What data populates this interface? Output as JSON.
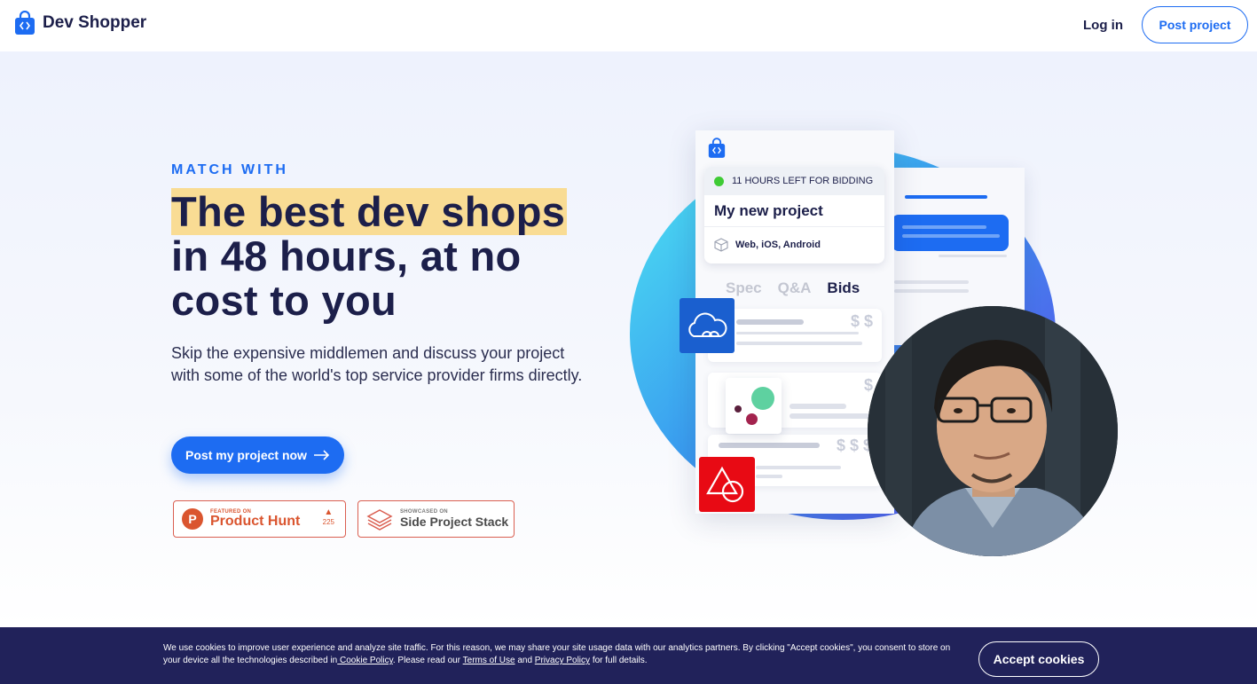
{
  "header": {
    "brand": "Dev Shopper",
    "login_label": "Log in",
    "post_project_label": "Post project"
  },
  "hero": {
    "eyebrow": "MATCH WITH",
    "headline_highlight": "The best dev shops",
    "headline_rest_1": "in 48 hours, at no",
    "headline_rest_2": "cost to you",
    "subtext": "Skip the expensive middlemen and discuss your project with some of the world's top service provider firms directly.",
    "cta_label": "Post my project now"
  },
  "badges": {
    "product_hunt": {
      "small": "FEATURED ON",
      "big": "Product Hunt",
      "count": "225"
    },
    "side_project_stack": {
      "small": "SHOWCASED ON",
      "big": "Side Project Stack"
    }
  },
  "illustration": {
    "bidding_status": "11 HOURS LEFT FOR BIDDING",
    "project_title": "My new project",
    "platforms": "Web, iOS, Android",
    "tabs": [
      "Spec",
      "Q&A",
      "Bids"
    ],
    "active_tab": "Bids",
    "prices": [
      "$ $",
      "$",
      "$ $ $"
    ]
  },
  "cookie": {
    "text_1": "We use cookies to improve user experience and analyze site traffic. For this reason, we may share your site usage data with our analytics partners. By clicking \"Accept cookies\", you consent to store on your device all the technologies described in",
    "cookie_policy_link": " Cookie Policy",
    "text_2": ". Please read our",
    "terms_link": "Terms of Use",
    "text_3": "and",
    "privacy_link": "Privacy Policy",
    "text_4": "for full details.",
    "accept_label": "Accept cookies"
  },
  "colors": {
    "primary": "#1d6cf2",
    "navy": "#1c1f4a",
    "highlight": "#f9dc94",
    "cookie_bg": "#21225a",
    "product_hunt": "#da552f"
  }
}
